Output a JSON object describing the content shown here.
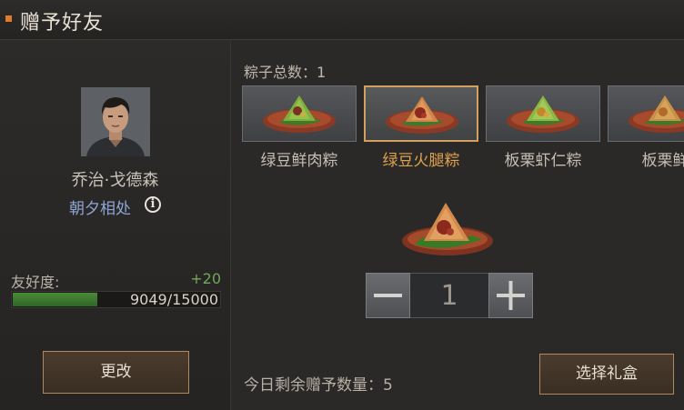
{
  "header": {
    "title": "赠予好友"
  },
  "friend": {
    "name": "乔治·戈德森",
    "relation": "朝夕相处",
    "favorability_label": "友好度:",
    "favorability_delta": "+20",
    "favorability_text": "9049/15000",
    "favorability_current": 9049,
    "favorability_max": 15000
  },
  "buttons": {
    "change": "更改",
    "choose_gift_box": "选择礼盒"
  },
  "gift": {
    "total_label": "粽子总数：1",
    "items": [
      {
        "label": "绿豆鲜肉粽",
        "selected": false
      },
      {
        "label": "绿豆火腿粽",
        "selected": true
      },
      {
        "label": "板栗虾仁粽",
        "selected": false
      },
      {
        "label": "板栗鲜",
        "selected": false
      }
    ],
    "quantity": "1",
    "remaining_label": "今日剩余赠予数量：5"
  },
  "colors": {
    "accent": "#e07a2e",
    "selected_border": "#d2a15f",
    "selected_text": "#e0a24e",
    "relation_text": "#8ea6d6",
    "favorability_delta": "#6ea85a",
    "favorability_bar": "#3a7a30"
  }
}
